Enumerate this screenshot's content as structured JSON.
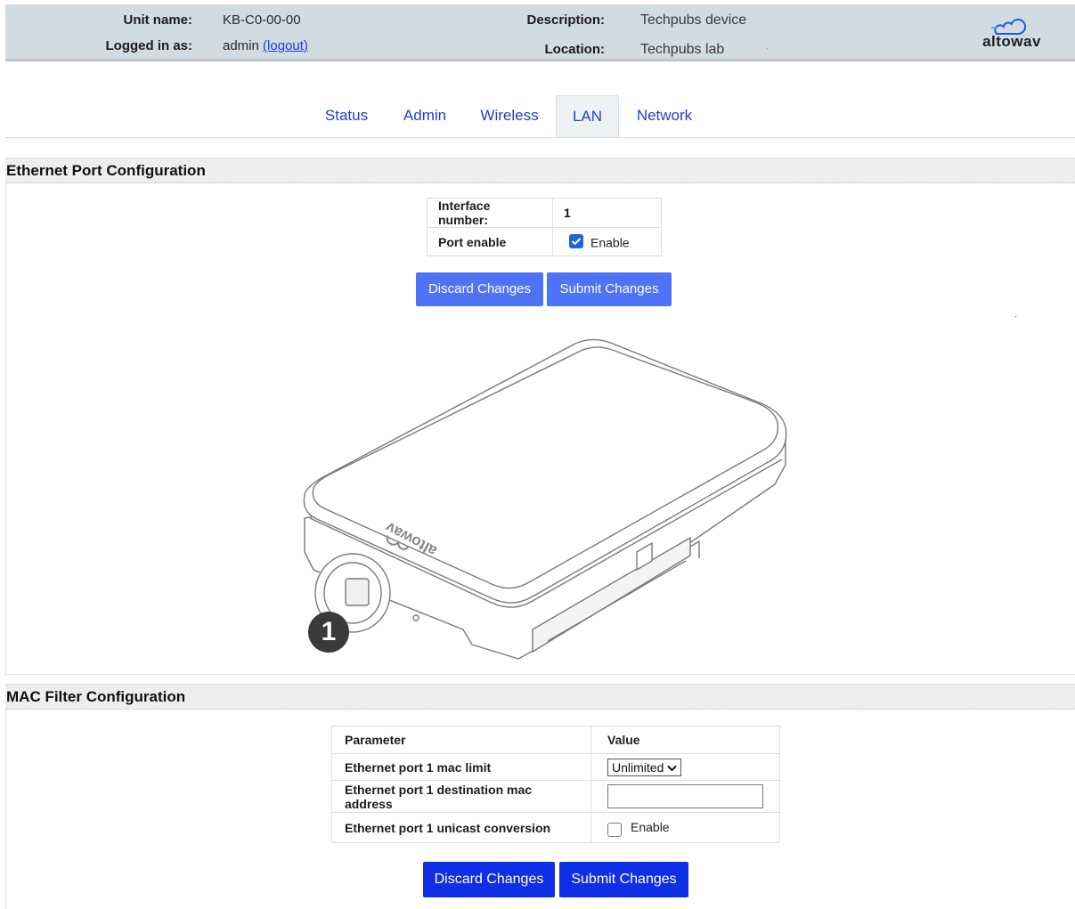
{
  "header": {
    "unit_name_label": "Unit name:",
    "unit_name_value": "KB-C0-00-00",
    "logged_in_label": "Logged in as:",
    "logged_in_user": "admin",
    "logout_link": "(logout)",
    "description_label": "Description:",
    "description_value": "Techpubs device",
    "location_label": "Location:",
    "location_value": "Techpubs lab",
    "logo_text": "altowav"
  },
  "tabs": [
    {
      "label": "Status",
      "active": false
    },
    {
      "label": "Admin",
      "active": false
    },
    {
      "label": "Wireless",
      "active": false
    },
    {
      "label": "LAN",
      "active": true
    },
    {
      "label": "Network",
      "active": false
    }
  ],
  "ethernet": {
    "title": "Ethernet Port Configuration",
    "interface_label": "Interface number:",
    "interface_value": "1",
    "port_enable_label": "Port enable",
    "port_enable_checkbox": "Enable",
    "port_enabled": true,
    "discard_label": "Discard Changes",
    "submit_label": "Submit Changes",
    "port_badge": "1",
    "device_logo": "altowav"
  },
  "mac_filter": {
    "title": "MAC Filter Configuration",
    "col_parameter": "Parameter",
    "col_value": "Value",
    "rows": [
      {
        "parameter": "Ethernet port 1 mac limit",
        "value": "Unlimited"
      },
      {
        "parameter": "Ethernet port 1 destination mac address",
        "value": ""
      },
      {
        "parameter": "Ethernet port 1 unicast conversion",
        "value": "Enable"
      }
    ],
    "unicast_enabled": false,
    "discard_label": "Discard Changes",
    "submit_label": "Submit Changes"
  },
  "colors": {
    "header_bg": "#d1dbe2",
    "tab_text": "#1e3fc8",
    "button_light": "#4f73f7",
    "button_dark": "#0f2fe6",
    "checkbox_checked": "#1e66d0"
  }
}
